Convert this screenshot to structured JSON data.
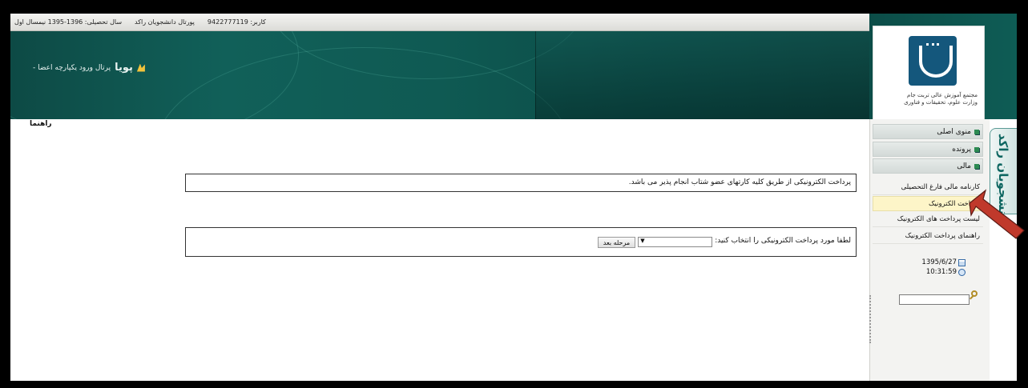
{
  "topbar": {
    "user": "کاربر: 9422777119",
    "portal": "پورتال دانشجویان راکد",
    "year": "سال تحصیلی: 1396-1395 نیمسال اول"
  },
  "brand": {
    "name": "پویا",
    "tagline": "- پرتال ورود یکپارچه اعضا"
  },
  "logo": {
    "caption_line1": "مجتمع آموزش عالی تربت جام",
    "caption_line2": "وزارت علوم، تحقیقات و فناوری"
  },
  "breadcrumb": "راهنما",
  "sidebar": {
    "tab_label": "دانشجویان راکد",
    "headers": [
      "منوی اصلی",
      "پرونده",
      "مالی"
    ],
    "items": [
      {
        "label": "کارنامه مالی فارغ التحصیلی",
        "active": false
      },
      {
        "label": "پرداخت الکترونیک",
        "active": true
      },
      {
        "label": "لیست پرداخت های الکترونیک",
        "active": false
      },
      {
        "label": "راهنمای پرداخت الکترونیک",
        "active": false
      }
    ],
    "date": "1395/6/27",
    "time": "10:31:59"
  },
  "main": {
    "notice": "پرداخت الکترونیکی از طریق کلیه کارتهای عضو شتاب انجام پذیر می باشد.",
    "select_label": "لطفا مورد پرداخت الکترونیکی را انتخاب کنید:",
    "select_value": "",
    "next_button": "مرحله بعد"
  },
  "colors": {
    "banner": "#0f5a53",
    "active_item": "#fdf5c8",
    "arrow": "#c0392b"
  }
}
